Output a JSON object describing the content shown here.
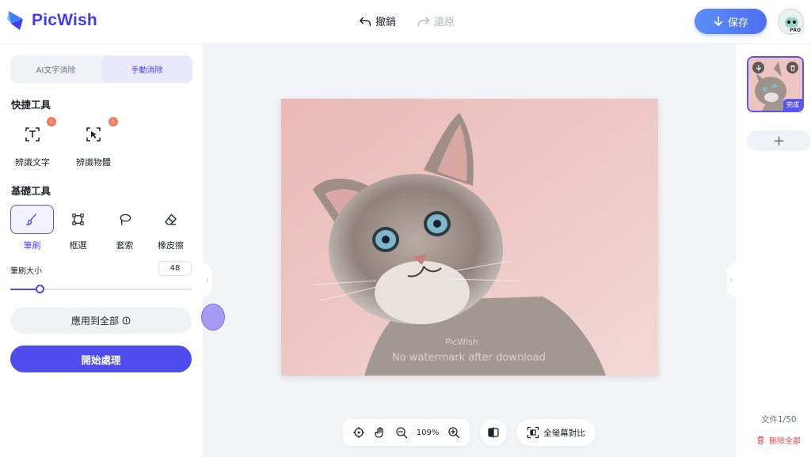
{
  "app": {
    "name": "PicWish"
  },
  "header": {
    "undo_label": "撤銷",
    "redo_label": "還原",
    "save_label": "保存",
    "pro_badge": "PRO"
  },
  "left_panel": {
    "mode_tabs": [
      {
        "label": "AI文字消除",
        "active": false
      },
      {
        "label": "手動消除",
        "active": true
      }
    ],
    "quick_tools_title": "快捷工具",
    "quick_tools": [
      {
        "label": "辨識文字",
        "icon": "text-detect-icon"
      },
      {
        "label": "辨識物體",
        "icon": "object-detect-icon"
      }
    ],
    "basic_tools_title": "基礎工具",
    "basic_tools": [
      {
        "label": "筆刷",
        "icon": "brush-icon",
        "active": true
      },
      {
        "label": "框選",
        "icon": "rectangle-select-icon",
        "active": false
      },
      {
        "label": "套索",
        "icon": "lasso-icon",
        "active": false
      },
      {
        "label": "橡皮擦",
        "icon": "eraser-icon",
        "active": false
      }
    ],
    "brush_size_label": "筆刷大小",
    "brush_size_value": "48",
    "brush_size_fraction": 0.16,
    "apply_all_label": "應用到全部",
    "start_label": "開始處理"
  },
  "canvas": {
    "watermark_brand": "PicWish",
    "watermark_text": "No watermark after download",
    "zoom_value": "109%",
    "fullscreen_compare_label": "全螢幕對比"
  },
  "right_panel": {
    "thumb_status": "完成",
    "add_label": "+",
    "doc_count": "文件1/50",
    "delete_all_label": "刪除全部"
  },
  "colors": {
    "brand": "#3f3df0",
    "accent": "#4e4bef",
    "danger": "#e5484d",
    "canvas_bg": "#f3f4f8"
  }
}
